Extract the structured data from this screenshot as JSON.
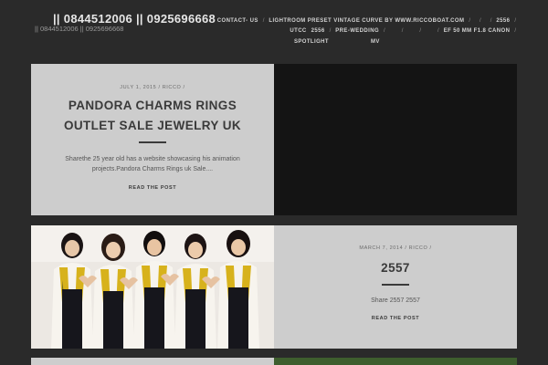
{
  "header": {
    "title": "|| 0844512006 || 0925696668",
    "tagline": "|| 0844512006 || 0925696668",
    "nav_row1": [
      "CONTACT- US",
      "LIGHTROOM PRESET VINTAGE CURVE BY WWW.RICCOBOAT.COM",
      "",
      "",
      "2556",
      ""
    ],
    "nav_row2": [
      "UTCC",
      "2556",
      "PRE-WEDDING",
      "",
      "",
      "",
      "EF 50 MM F1.8 CANON",
      ""
    ],
    "nav_row3": [
      "SPOTLIGHT",
      "MV"
    ]
  },
  "posts": [
    {
      "meta": "JULY 1, 2015 / RICCO /",
      "title": "PANDORA CHARMS RINGS OUTLET SALE JEWELRY UK",
      "excerpt": "Sharethe 25 year old has a website showcasing his animation projects.Pandora Charms Rings uk Sale....",
      "read_more": "READ THE POST"
    },
    {
      "meta": "MARCH 7, 2014 / RICCO /",
      "title": "2557",
      "excerpt": "Share   2557     2557",
      "read_more": "READ THE POST"
    }
  ],
  "colors": {
    "page_bg": "#2a2a2a",
    "card_light": "#cdcdcd",
    "card_dark": "#141414",
    "text_dark": "#3a3a3a"
  }
}
